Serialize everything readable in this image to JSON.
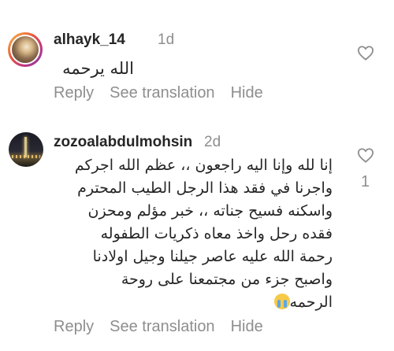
{
  "comments": [
    {
      "username": "alhayk_14",
      "time": "1d",
      "text": "الله يرحمه",
      "actions": {
        "reply": "Reply",
        "translate": "See translation",
        "hide": "Hide"
      },
      "likes": ""
    },
    {
      "username": "zozoalabdulmohsin",
      "time": "2d",
      "text_lines": [
        "إنا لله وإنا اليه راجعون ،، عظم الله اجركم",
        "واجرنا في فقد هذا الرجل الطيب المحترم",
        "واسكنه فسيح جناته ،، خبر مؤلم ومحزن",
        "فقده رحل واخذ معاه ذكريات الطفوله",
        "رحمة الله عليه عاصر جيلنا وجيل اولادنا",
        "واصبح جزء من مجتمعنا على روحة",
        "الرحمه"
      ],
      "actions": {
        "reply": "Reply",
        "translate": "See translation",
        "hide": "Hide"
      },
      "likes": "1"
    }
  ],
  "icons": {
    "like": "heart-outline-icon",
    "crying_emoji": "loudly-crying-face-icon"
  }
}
